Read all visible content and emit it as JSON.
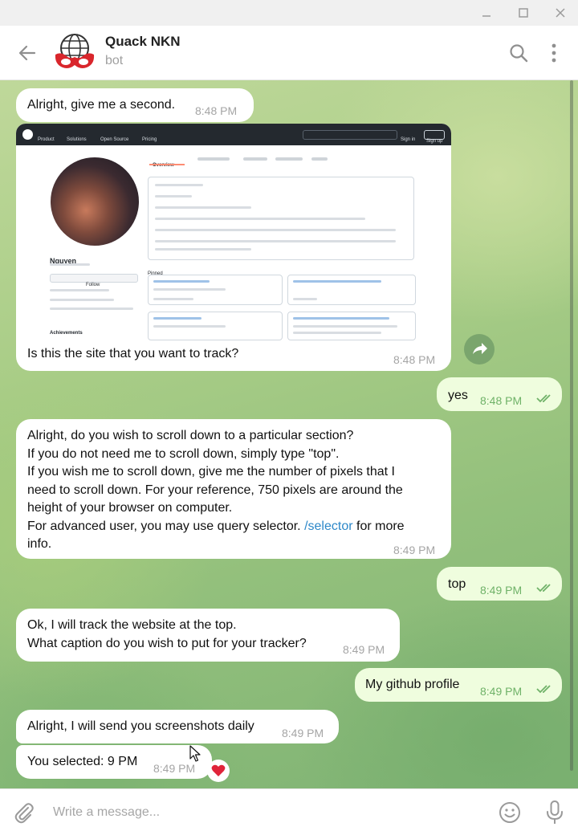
{
  "window": {
    "controls": [
      "minimize-icon",
      "maximize-icon",
      "close-icon"
    ]
  },
  "header": {
    "title": "Quack NKN",
    "subtitle": "bot",
    "icons": [
      "back-arrow-icon",
      "search-icon",
      "more-vertical-icon"
    ]
  },
  "messages": [
    {
      "dir": "in",
      "text": "Alright, give me a second.",
      "time": "8:48 PM"
    },
    {
      "dir": "in",
      "text": "Is this the site that you want to track?",
      "time": "8:48 PM",
      "screenshot": {
        "nav": [
          "Product",
          "Solutions",
          "Open Source",
          "Pricing"
        ],
        "sign_in": "Sign in",
        "sign_up": "Sign up",
        "profile_name": "Nguyen",
        "follow": "Follow",
        "tab": "Overview",
        "section_pinned": "Pinned",
        "section_achievements": "Achievements"
      }
    },
    {
      "dir": "out",
      "text": "yes",
      "time": "8:48 PM"
    },
    {
      "dir": "in",
      "lines": [
        "Alright, do you wish to scroll down to a particular section?",
        "If you do not need me to scroll down, simply type \"top\".",
        "If you wish me to scroll down, give me the number of pixels that I",
        "need to scroll down. For your reference, 750 pixels are around the",
        "height of your browser on computer."
      ],
      "line6_pre": "For advanced user, you may use query selector. ",
      "line6_link": "/selector",
      "line6_post": " for more",
      "line7": "info.",
      "time": "8:49 PM"
    },
    {
      "dir": "out",
      "text": "top",
      "time": "8:49 PM"
    },
    {
      "dir": "in",
      "lines": [
        "Ok, I will track the website at the top.",
        "What caption do you wish to put for your tracker?"
      ],
      "time": "8:49 PM"
    },
    {
      "dir": "out",
      "text": "My github profile",
      "time": "8:49 PM"
    },
    {
      "dir": "in",
      "text": "Alright, I will send you screenshots daily",
      "time": "8:49 PM"
    },
    {
      "dir": "in",
      "text": "You selected: 9 PM",
      "time": "8:49 PM",
      "reaction": "heart-icon"
    }
  ],
  "composer": {
    "placeholder": "Write a message...",
    "icons": [
      "attach-icon",
      "emoji-icon",
      "microphone-icon"
    ]
  },
  "colors": {
    "incoming_bubble": "#ffffff",
    "outgoing_bubble": "#effdde",
    "outgoing_time": "#6fb268",
    "link": "#2d88c9"
  }
}
